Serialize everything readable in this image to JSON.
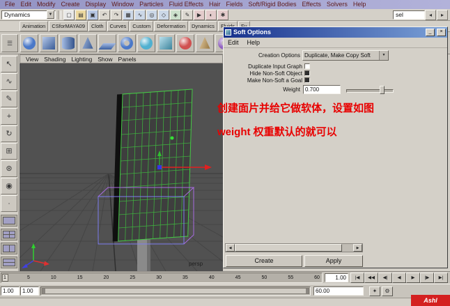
{
  "menubar": {
    "items": [
      "File",
      "Edit",
      "Modify",
      "Create",
      "Display",
      "Window",
      "Particles",
      "Fluid Effects",
      "Hair",
      "Fields",
      "Soft/Rigid Bodies",
      "Effects",
      "Solvers",
      "Help"
    ]
  },
  "statusline": {
    "mode": "Dynamics",
    "sel_text": "sel",
    "icons": [
      {
        "name": "new-scene-icon",
        "glyph": "▢",
        "color": "#e8e8e8"
      },
      {
        "name": "open-scene-icon",
        "glyph": "▤",
        "color": "#ecd9a0"
      },
      {
        "name": "save-scene-icon",
        "glyph": "▣",
        "color": "#b8c8e4"
      },
      {
        "name": "undo-icon",
        "glyph": "↶",
        "color": "#dcd8d0"
      },
      {
        "name": "redo-icon",
        "glyph": "↷",
        "color": "#dcd8d0"
      },
      {
        "name": "snap-to-grid-icon",
        "glyph": "▦",
        "color": "#ccd8e8"
      },
      {
        "name": "snap-to-curve-icon",
        "glyph": "∿",
        "color": "#ccd8e8"
      },
      {
        "name": "snap-to-point-icon",
        "glyph": "◎",
        "color": "#ccd8e8"
      },
      {
        "name": "snap-to-plane-icon",
        "glyph": "◇",
        "color": "#ccd8e8"
      },
      {
        "name": "make-live-icon",
        "glyph": "◈",
        "color": "#cce0cc"
      },
      {
        "name": "construction-history-icon",
        "glyph": "✎",
        "color": "#dcd8d0"
      },
      {
        "name": "render-current-frame-icon",
        "glyph": "▶",
        "color": "#e4cccc"
      },
      {
        "name": "ipr-render-icon",
        "glyph": "◐",
        "color": "#e4cccc"
      },
      {
        "name": "render-settings-icon",
        "glyph": "✱",
        "color": "#e4cccc"
      }
    ],
    "right_icons": [
      {
        "name": "collapse-left-icon",
        "glyph": "◂",
        "color": "#d4d0c8"
      },
      {
        "name": "collapse-right-icon",
        "glyph": "▸",
        "color": "#d4d0c8"
      }
    ]
  },
  "shelf": {
    "tabs": [
      "Animation",
      "CSforMAYA09",
      "Cloth",
      "Curves",
      "Custom",
      "Deformation",
      "Dynamics",
      "Fluids",
      "Fu"
    ],
    "items": [
      {
        "name": "shelf-sphere-icon",
        "shape": "sphere",
        "color": "#4a78c8"
      },
      {
        "name": "shelf-cube-icon",
        "shape": "cube",
        "color": "#4a78c8"
      },
      {
        "name": "shelf-cylinder-icon",
        "shape": "cyl",
        "color": "#4a78c8"
      },
      {
        "name": "shelf-cone-icon",
        "shape": "cone",
        "color": "#4a78c8"
      },
      {
        "name": "shelf-plane-icon",
        "shape": "plane",
        "color": "#4a78c8"
      },
      {
        "name": "shelf-torus-icon",
        "shape": "torus",
        "color": "#4a78c8"
      },
      {
        "name": "shelf-nurbs-sphere-icon",
        "shape": "sphere",
        "color": "#50b0d0"
      },
      {
        "name": "shelf-nurbs-cube-icon",
        "shape": "cube",
        "color": "#50b0d0"
      },
      {
        "name": "shelf-particles-icon",
        "shape": "sphere",
        "color": "#d05050"
      },
      {
        "name": "shelf-emitter-icon",
        "shape": "cone",
        "color": "#d0a050"
      },
      {
        "name": "shelf-field-icon",
        "shape": "torus",
        "color": "#9060c0"
      }
    ]
  },
  "toolbox": {
    "tools": [
      {
        "name": "select-tool-icon",
        "glyph": "↖"
      },
      {
        "name": "lasso-tool-icon",
        "glyph": "∿"
      },
      {
        "name": "paint-select-tool-icon",
        "glyph": "✎"
      },
      {
        "name": "move-tool-icon",
        "glyph": "+"
      },
      {
        "name": "rotate-tool-icon",
        "glyph": "↻"
      },
      {
        "name": "scale-tool-icon",
        "glyph": "⊞"
      },
      {
        "name": "universal-manipulator-icon",
        "glyph": "⊛"
      },
      {
        "name": "soft-mod-tool-icon",
        "glyph": "◉"
      },
      {
        "name": "last-tool-icon",
        "glyph": "∙"
      }
    ],
    "layouts": [
      {
        "name": "single-pane-layout-button",
        "shape": "single"
      },
      {
        "name": "four-pane-layout-button",
        "shape": "four"
      },
      {
        "name": "two-pane-side-layout-button",
        "shape": "two-v"
      },
      {
        "name": "two-pane-stacked-layout-button",
        "shape": "two-h"
      }
    ]
  },
  "panel_menu": {
    "items": [
      "View",
      "Shading",
      "Lighting",
      "Show",
      "Panels"
    ]
  },
  "viewport": {
    "camera_label": "persp"
  },
  "annotation": {
    "line1": "创建面片并给它做软体，设置如图",
    "line2": "weight 权重默认的就可以",
    "color": "#e80000"
  },
  "dialog": {
    "title": "Soft Options",
    "menus": [
      "Edit",
      "Help"
    ],
    "creation_options_label": "Creation Options",
    "creation_options_value": "Duplicate, Make Copy Soft",
    "checkboxes": [
      {
        "name": "duplicate-input-graph-checkbox",
        "label": "Duplicate Input Graph",
        "checked": false
      },
      {
        "name": "hide-non-soft-object-checkbox",
        "label": "Hide Non-Soft Object",
        "checked": true
      },
      {
        "name": "make-non-soft-goal-checkbox",
        "label": "Make Non-Soft a Goal",
        "checked": true
      }
    ],
    "weight_label": "Weight",
    "weight_value": "0.700",
    "create_button": "Create",
    "apply_button": "Apply",
    "titlebar_colors": {
      "start": "#16308c",
      "end": "#7ca2d8"
    }
  },
  "timeline": {
    "ticks": [
      "1",
      "5",
      "10",
      "15",
      "20",
      "25",
      "30",
      "35",
      "40",
      "45",
      "50",
      "55",
      "60"
    ],
    "current_time": "1.00",
    "transport": [
      {
        "name": "go-to-start-button",
        "glyph": "|◀"
      },
      {
        "name": "step-back-frame-button",
        "glyph": "◀◀"
      },
      {
        "name": "step-back-key-button",
        "glyph": "◀|"
      },
      {
        "name": "play-backwards-button",
        "glyph": "◀"
      },
      {
        "name": "play-forwards-button",
        "glyph": "▶"
      },
      {
        "name": "step-forward-key-button",
        "glyph": "|▶"
      },
      {
        "name": "go-to-end-button",
        "glyph": "▶|"
      }
    ]
  },
  "range": {
    "playback_start": "1.00",
    "anim_start": "1.00",
    "anim_end": "60.00"
  },
  "watermark": "Ashl"
}
